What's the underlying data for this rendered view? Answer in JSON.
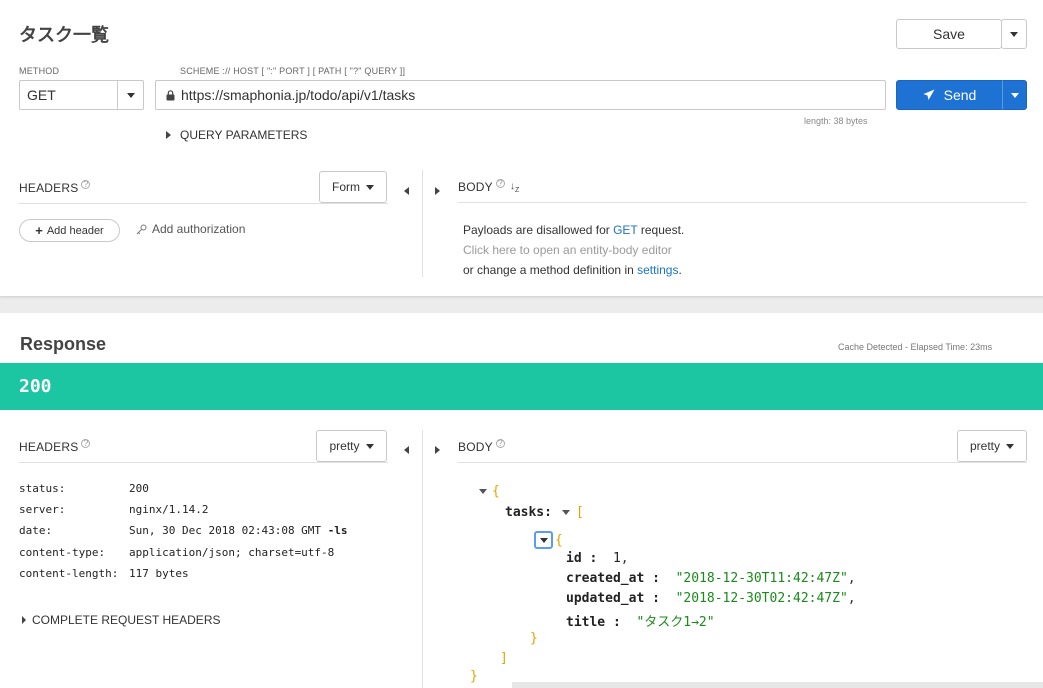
{
  "request": {
    "title": "タスク一覧",
    "save_label": "Save",
    "method_label": "METHOD",
    "method_value": "GET",
    "url_label": "SCHEME :// HOST [ \":\" PORT ] [ PATH [ \"?\" QUERY ]]",
    "url_value": "https://smaphonia.jp/todo/api/v1/tasks",
    "url_length": "length: 38 bytes",
    "send_label": "Send",
    "query_params_label": "QUERY PARAMETERS",
    "headers_label": "HEADERS",
    "headers_mode": "Form",
    "add_header_label": "Add header",
    "add_auth_label": "Add authorization",
    "body_label": "BODY",
    "body_msg": {
      "line1_pre": "Payloads are disallowed for ",
      "line1_method": "GET",
      "line1_post": " request.",
      "line2": "Click here to open an entity-body editor",
      "line3_pre": "or change a method definition in ",
      "line3_link": "settings",
      "line3_post": "."
    }
  },
  "response": {
    "title": "Response",
    "meta": "Cache Detected - Elapsed Time: 23ms",
    "status_code": "200",
    "status_color": "#1dc6a3",
    "headers_label": "HEADERS",
    "headers_mode": "pretty",
    "body_label": "BODY",
    "body_mode": "pretty",
    "headers": [
      {
        "key": "status:",
        "value": "200"
      },
      {
        "key": "server:",
        "value": "nginx/1.14.2"
      },
      {
        "key": "date:",
        "value": "Sun, 30 Dec 2018 02:43:08 GMT",
        "suffix": "-ls"
      },
      {
        "key": "content-type:",
        "value": "application/json; charset=utf-8"
      },
      {
        "key": "content-length:",
        "value": "117 bytes"
      }
    ],
    "complete_headers_label": "COMPLETE REQUEST HEADERS",
    "json": {
      "open_brace": "{",
      "tasks_key": "tasks",
      "colon": " :",
      "open_bracket": "[",
      "item_open": "{",
      "id_key": "id",
      "id_value": "1",
      "created_key": "created_at",
      "created_value": "\"2018-12-30T11:42:47Z\"",
      "updated_key": "updated_at",
      "updated_value": "\"2018-12-30T02:42:47Z\"",
      "title_key": "title",
      "title_value": "\"タスク1→2\"",
      "comma": ",",
      "item_close": "}",
      "close_bracket": "]",
      "close_brace": "}"
    }
  }
}
